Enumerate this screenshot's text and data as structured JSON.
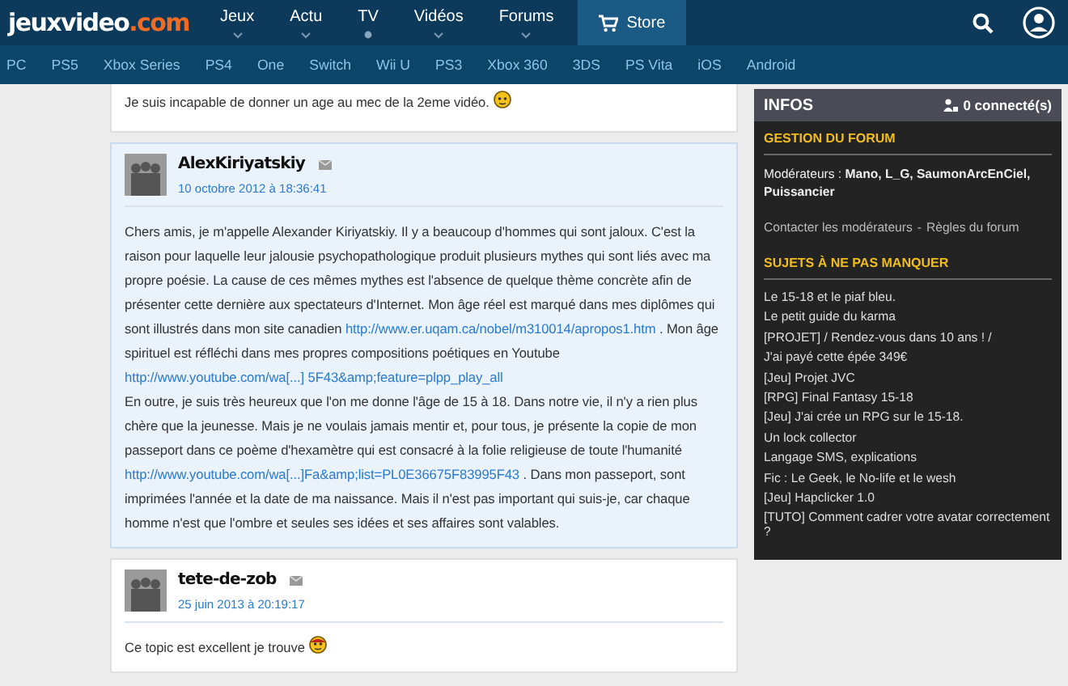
{
  "header": {
    "logo": {
      "main": "jeuxvideo",
      "suffix": ".com"
    },
    "nav": [
      {
        "label": "Jeux",
        "kind": "chevron",
        "selected": false
      },
      {
        "label": "Actu",
        "kind": "chevron",
        "selected": false
      },
      {
        "label": "TV",
        "kind": "dot",
        "selected": false
      },
      {
        "label": "Vidéos",
        "kind": "chevron",
        "selected": false
      },
      {
        "label": "Forums",
        "kind": "chevron",
        "selected": false
      },
      {
        "label": "Store",
        "kind": "cart",
        "selected": true
      }
    ]
  },
  "platforms": [
    "PC",
    "PS5",
    "Xbox Series",
    "PS4",
    "One",
    "Switch",
    "Wii U",
    "PS3",
    "Xbox 360",
    "3DS",
    "PS Vita",
    "iOS",
    "Android"
  ],
  "posts": [
    {
      "highlighted": false,
      "paragraphs": [
        [
          {
            "kind": "text",
            "text": "Je suis incapable de donner un age au mec de la 2eme vidéo."
          },
          {
            "kind": "smiley"
          }
        ]
      ]
    },
    {
      "author": "AlexKiriyatskiy",
      "date": "10 octobre 2012 à 18:36:41",
      "highlighted": true,
      "paragraphs": [
        [
          {
            "kind": "text",
            "text": "Chers amis, je m'appelle Alexander Kiriyatskiy. Il y a beaucoup d'hommes qui sont jaloux. C'est la raison pour laquelle leur jalousie psychopathologique produit plusieurs mythes qui sont liés avec ma propre poésie. La cause de ces mêmes mythes est l'absence de quelque thème concrète afin de présenter cette dernière aux spectateurs d'Internet. Mon âge réel est marqué dans mes diplômes qui sont illustrés dans mon site canadien"
          },
          {
            "kind": "link",
            "text": "http://www.er.uqam.ca/nobel/m310014/apropos1.htm"
          },
          {
            "kind": "text",
            "text": ". Mon âge spirituel est réfléchi dans mes propres compositions poétiques en Youtube"
          },
          {
            "kind": "link",
            "text": "http://www.youtube.com/wa[...]"
          },
          {
            "kind": "link",
            "text": "5F43&amp;feature=plpp_play_all"
          }
        ],
        [
          {
            "kind": "text",
            "text": "En outre, je suis très heureux que l'on me donne l'âge de 15 à 18. Dans notre vie, il n'y a rien plus chère que la jeunesse. Mais je ne voulais jamais mentir et, pour tous, je présente la copie de mon passeport dans ce poème d'hexamètre qui est consacré à la folie religieuse de toute l'humanité"
          },
          {
            "kind": "link",
            "text": "http://www.youtube.com/wa[...]Fa&amp;list=PL0E36675F83995F43"
          },
          {
            "kind": "text",
            "text": ". Dans mon passeport, sont imprimées l'année et la date de ma naissance. Mais il n'est pas important qui suis-je, car chaque homme n'est que l'ombre et seules ses idées et ses affaires sont valables."
          }
        ]
      ]
    },
    {
      "author": "tete-de-zob",
      "date": "25 juin 2013 à 20:19:17",
      "highlighted": false,
      "paragraphs": [
        [
          {
            "kind": "text",
            "text": "Ce topic est excellent je trouve"
          },
          {
            "kind": "smiley-pirate"
          }
        ]
      ]
    }
  ],
  "sidebar": {
    "title": "INFOS",
    "online": "0 connecté(s)",
    "management": {
      "heading": "GESTION DU FORUM",
      "moderators": "Modérateurs : **Mano, L_G, SaumonArcEnCiel, Puissancier**",
      "links": [
        "Contacter les modérateurs",
        "Règles du forum"
      ],
      "separator": "-"
    },
    "featured": {
      "heading": "SUJETS À NE PAS MANQUER",
      "topics": [
        "Le 15-18 et le piaf bleu.",
        "Le petit guide du karma",
        "[PROJET] / Rendez-vous dans 10 ans ! /",
        "J'ai payé cette épée 349€",
        "[Jeu] Projet JVC",
        "[RPG] Final Fantasy 15-18",
        "[Jeu] J'ai crée un RPG sur le 15-18.",
        "Un lock collector",
        "Langage SMS, explications",
        "Fic : Le Geek, le No-life et le wesh",
        "[Jeu] Hapclicker 1.0",
        "[TUTO] Comment cadrer votre avatar correctement ?"
      ]
    }
  }
}
